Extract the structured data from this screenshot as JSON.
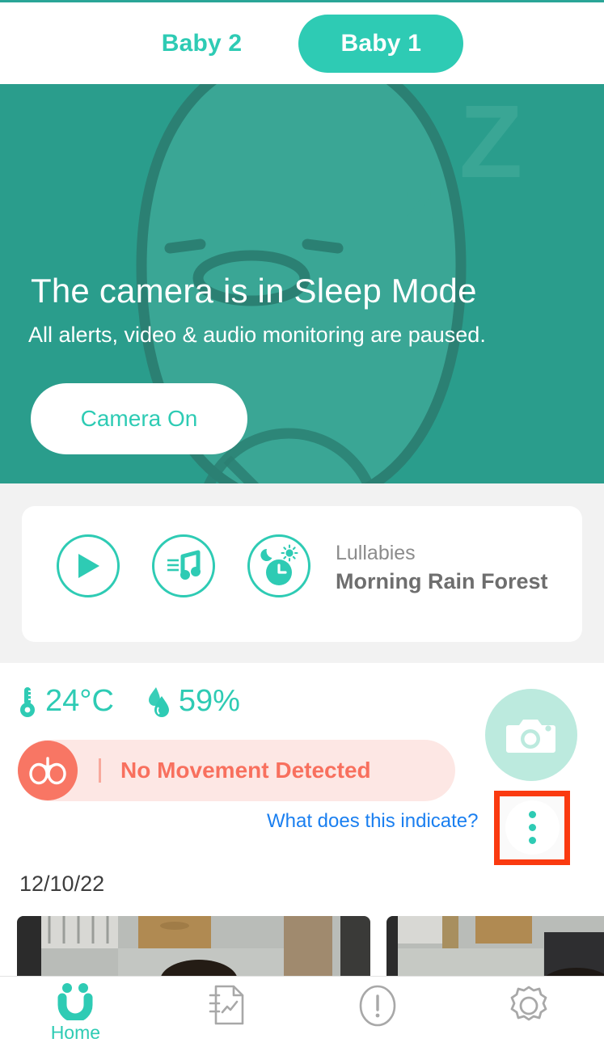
{
  "tabs": [
    {
      "label": "Baby 2",
      "active": false
    },
    {
      "label": "Baby 1",
      "active": true
    }
  ],
  "hero": {
    "title": "The camera is in Sleep Mode",
    "subtitle": "All alerts, video & audio monitoring are paused.",
    "camera_on_label": "Camera On",
    "sleep_z_big": "Z",
    "sleep_z_small": "z",
    "speaker_icon": "speaker-on-icon",
    "background_color": "#2a9d8c"
  },
  "lullaby": {
    "play_icon": "play-icon",
    "playlist_icon": "music-note-icon",
    "timer_icon": "day-night-timer-icon",
    "label": "Lullabies",
    "track": "Morning Rain Forest"
  },
  "sensors": {
    "temperature": "24°C",
    "temperature_icon": "thermometer-icon",
    "humidity": "59%",
    "humidity_icon": "water-drop-icon",
    "movement_status": "No Movement Detected",
    "movement_icon": "lungs-icon",
    "movement_color": "#f8705e",
    "indicate_link": "What does this indicate?",
    "indicate_link_color": "#1a7ff0",
    "camera_icon": "camera-icon",
    "overflow_icon": "three-dot-menu-icon",
    "highlight_color": "#fa3a10"
  },
  "timeline": {
    "date": "12/10/22",
    "thumbnails": [
      {
        "name": "clip-thumbnail-1"
      },
      {
        "name": "clip-thumbnail-2"
      }
    ]
  },
  "bottom_nav": [
    {
      "label": "Home",
      "icon": "smiley-home-icon",
      "active": true
    },
    {
      "label": "",
      "icon": "report-document-icon",
      "active": false
    },
    {
      "label": "",
      "icon": "alert-exclamation-icon",
      "active": false
    },
    {
      "label": "",
      "icon": "settings-gear-icon",
      "active": false
    }
  ],
  "colors": {
    "accent": "#2ecbb4",
    "hero_bg": "#2a9d8c",
    "alert": "#f8705e",
    "link": "#1a7ff0"
  }
}
